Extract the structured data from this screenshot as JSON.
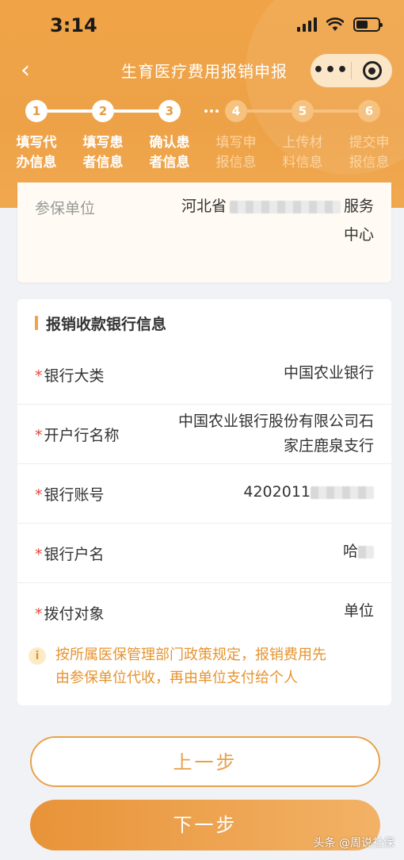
{
  "status_bar": {
    "time": "3:14"
  },
  "nav": {
    "back": "‹",
    "title": "生育医疗费用报销申报",
    "more": "•••"
  },
  "steps": [
    {
      "num": "1",
      "line1": "填写代",
      "line2": "办信息",
      "state": "done"
    },
    {
      "num": "2",
      "line1": "填写患",
      "line2": "者信息",
      "state": "done"
    },
    {
      "num": "3",
      "line1": "确认患",
      "line2": "者信息",
      "state": "current"
    },
    {
      "num": "4",
      "line1": "填写申",
      "line2": "报信息",
      "state": "pending"
    },
    {
      "num": "5",
      "line1": "上传材",
      "line2": "料信息",
      "state": "pending"
    },
    {
      "num": "6",
      "line1": "提交申",
      "line2": "报信息",
      "state": "pending"
    }
  ],
  "insured_unit": {
    "label": "参保单位",
    "value_line1": "河北省",
    "value_line1_end": "服务",
    "value_line2": "中心"
  },
  "bank_section": {
    "title": "报销收款银行信息",
    "fields": [
      {
        "label": "银行大类",
        "value": "中国农业银行"
      },
      {
        "label": "开户行名称",
        "value_line1": "中国农业银行股份有限公司石",
        "value_line2": "家庄鹿泉支行"
      },
      {
        "label": "银行账号",
        "value": "4202011"
      },
      {
        "label": "银行户名",
        "value": "哈"
      },
      {
        "label": "拨付对象",
        "value": "单位"
      }
    ],
    "required_mark": "*",
    "notice_line1": "按所属医保管理部门政策规定，报销费用先",
    "notice_line2": "由参保单位代收，再由单位支付给个人"
  },
  "buttons": {
    "prev": "上一步",
    "next": "下一步"
  },
  "watermark": "头条 @周说社保",
  "colors": {
    "accent": "#f0a447",
    "required": "#e6453a",
    "notice": "#e6942f"
  },
  "icons": {
    "back": "chevron-left-icon",
    "more": "more-dots-icon",
    "close": "close-circle-icon",
    "info": "info-icon"
  }
}
